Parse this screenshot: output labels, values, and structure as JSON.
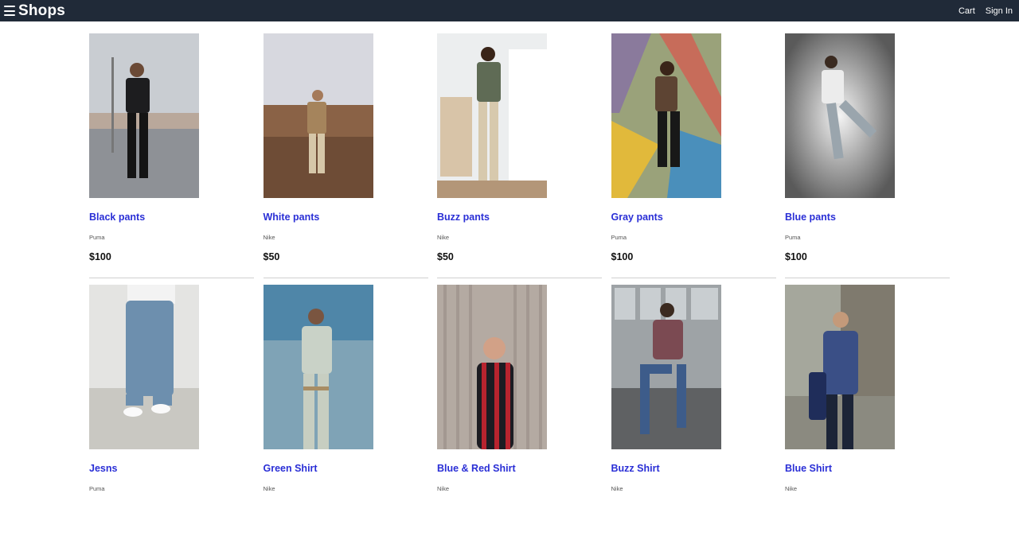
{
  "header": {
    "brand": "Shops",
    "nav": {
      "cart": "Cart",
      "sign_in": "Sign In"
    }
  },
  "products": [
    {
      "title": "Black pants",
      "brand": "Puma",
      "price": "$100"
    },
    {
      "title": "White pants",
      "brand": "Nike",
      "price": "$50"
    },
    {
      "title": "Buzz pants",
      "brand": "Nike",
      "price": "$50"
    },
    {
      "title": "Gray pants",
      "brand": "Puma",
      "price": "$100"
    },
    {
      "title": "Blue pants",
      "brand": "Puma",
      "price": "$100"
    },
    {
      "title": "Jesns",
      "brand": "Puma",
      "price": ""
    },
    {
      "title": "Green Shirt",
      "brand": "Nike",
      "price": ""
    },
    {
      "title": "Blue & Red Shirt",
      "brand": "Nike",
      "price": ""
    },
    {
      "title": "Buzz Shirt",
      "brand": "Nike",
      "price": ""
    },
    {
      "title": "Blue Shirt",
      "brand": "Nike",
      "price": ""
    }
  ]
}
